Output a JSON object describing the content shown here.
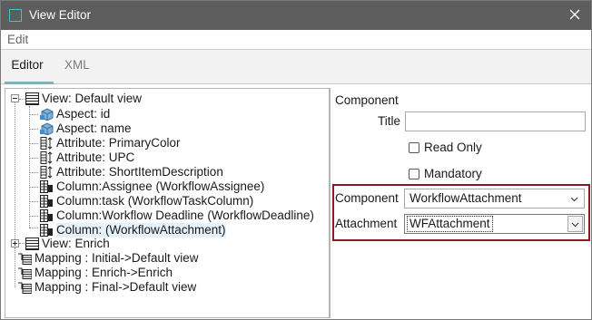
{
  "window": {
    "title": "View Editor",
    "close_label": "✕"
  },
  "menu": {
    "edit": "Edit"
  },
  "tabs": {
    "editor": "Editor",
    "xml": "XML"
  },
  "tree": {
    "root_view": "View: Default view",
    "items": [
      "Aspect: id",
      "Aspect: name",
      "Attribute: PrimaryColor",
      "Attribute: UPC",
      "Attribute: ShortItemDescription",
      "Column:Assignee (WorkflowAssignee)",
      "Column:task (WorkflowTaskColumn)",
      "Column:Workflow Deadline (WorkflowDeadline)",
      "Column: (WorkflowAttachment)"
    ],
    "enrich_view": "View: Enrich",
    "mappings": [
      "Mapping : Initial->Default view",
      "Mapping : Enrich->Enrich",
      "Mapping : Final->Default view"
    ]
  },
  "props": {
    "section_title": "Component",
    "title_label": "Title",
    "title_value": "",
    "read_only_label": "Read Only",
    "read_only_checked": false,
    "mandatory_label": "Mandatory",
    "mandatory_checked": false,
    "component_label": "Component",
    "component_value": "WorkflowAttachment",
    "attachment_label": "Attachment",
    "attachment_value": "WFAttachment"
  },
  "colors": {
    "titlebar": "#5d5d5d",
    "tab_underline": "#88aebc",
    "highlight_border": "#8b1a22"
  }
}
